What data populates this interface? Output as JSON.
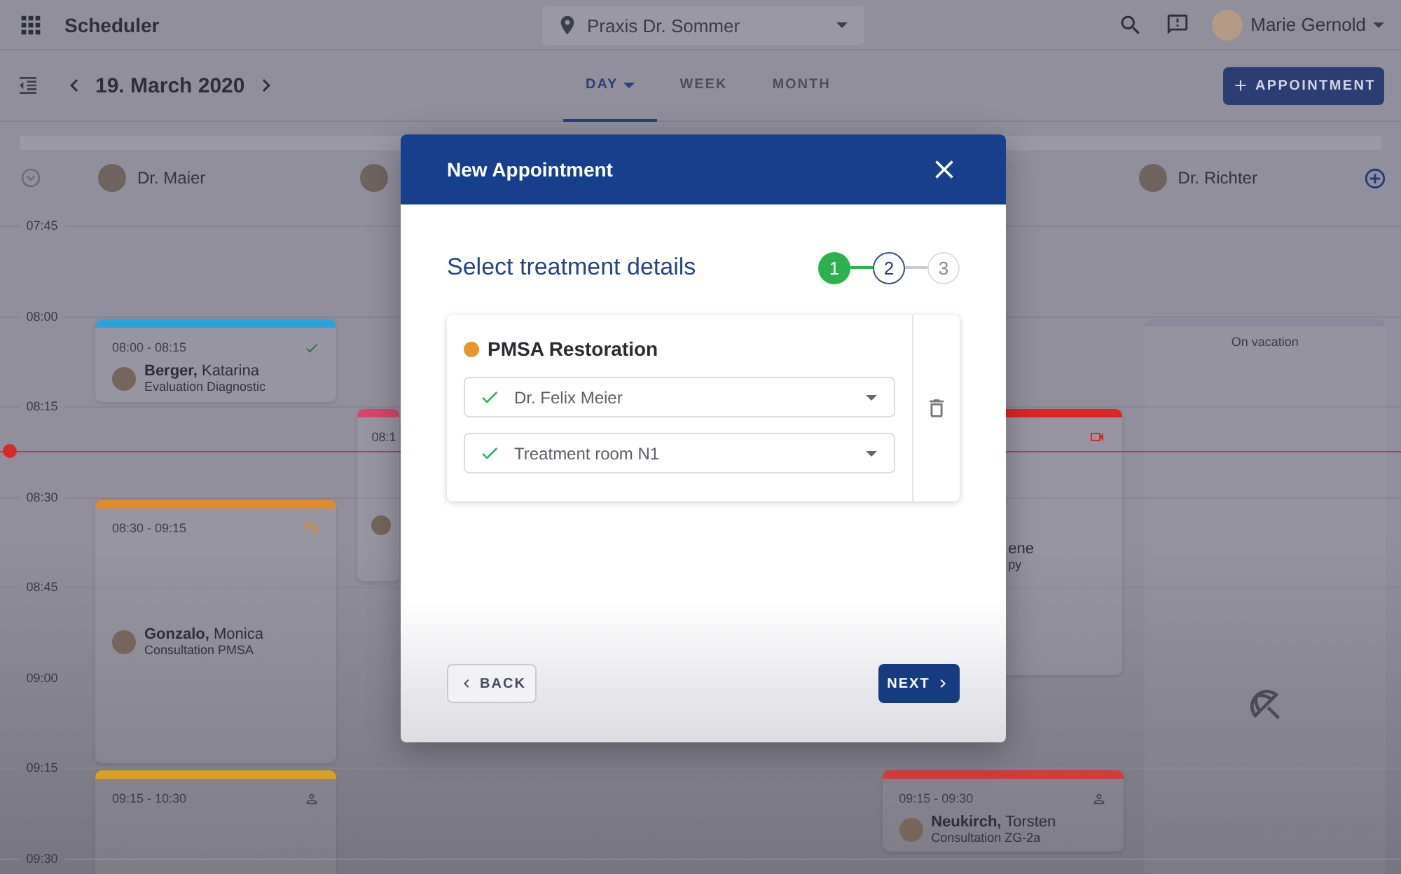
{
  "app": {
    "title": "Scheduler",
    "location": "Praxis Dr. Sommer",
    "user": "Marie Gernold"
  },
  "toolbar": {
    "date": "19. March 2020",
    "new_button": "APPOINTMENT",
    "tabs": [
      {
        "label": "DAY",
        "selected": true
      },
      {
        "label": "WEEK",
        "selected": false
      },
      {
        "label": "MONTH",
        "selected": false
      }
    ]
  },
  "time_slots": [
    "07:45",
    "08:00",
    "08:15",
    "08:30",
    "08:45",
    "09:00",
    "09:15",
    "09:30"
  ],
  "columns": [
    {
      "name": "Dr. Maier",
      "avatar": true,
      "appointments": [
        {
          "kind": "appointment",
          "time": "08:00 - 08:15",
          "patient": "**Berger,** Katarina",
          "treatment": "Evaluation Diagnostic",
          "color": "#2aa3dc",
          "indicator": {
            "kind": "check"
          }
        },
        {
          "kind": "appointment",
          "time": "08:30 - 09:15",
          "patient": "**Gonzalo,** Monica",
          "treatment": "Consultation PMSA",
          "color": "#e08a2c",
          "indicator": {
            "kind": "video"
          }
        },
        {
          "kind": "appointment",
          "time": "09:15 - 10:30",
          "color": "#d9a21e",
          "indicator": {
            "kind": "person"
          }
        }
      ]
    },
    {
      "avatar": true,
      "appointments": [
        {
          "kind": "appointment",
          "time": "08:1",
          "color": "#d8446a"
        }
      ]
    },
    {
      "appointments": [
        {
          "kind": "partial",
          "patient": "ene",
          "treatment": "py",
          "color": "#e02424",
          "indicator": {
            "kind": "video"
          }
        },
        {
          "kind": "appointment",
          "time": "09:15 - 09:30",
          "patient": "**Neukirch,** Torsten",
          "treatment": "Consultation ZG-2a",
          "color": "#d83a3a",
          "indicator": {
            "kind": "person"
          }
        }
      ]
    },
    {
      "name": "Dr. Richter",
      "avatar": true,
      "appointments": [
        {
          "kind": "vacation",
          "label": "On vacation"
        }
      ]
    }
  ],
  "modal": {
    "title": "New Appointment",
    "heading": "Select treatment details",
    "steps": [
      {
        "label": "1",
        "completed": true,
        "selected": false
      },
      {
        "label": "2",
        "completed": false,
        "selected": true
      },
      {
        "label": "3",
        "completed": false,
        "selected": false
      }
    ],
    "treatment": {
      "name": "PMSA Restoration",
      "color": "#e8952a",
      "fields": [
        {
          "value": "Dr. Felix Meier",
          "valid": true
        },
        {
          "value": "Treatment room N1",
          "valid": true
        }
      ]
    },
    "back_button": "BACK",
    "next_button": "NEXT"
  }
}
